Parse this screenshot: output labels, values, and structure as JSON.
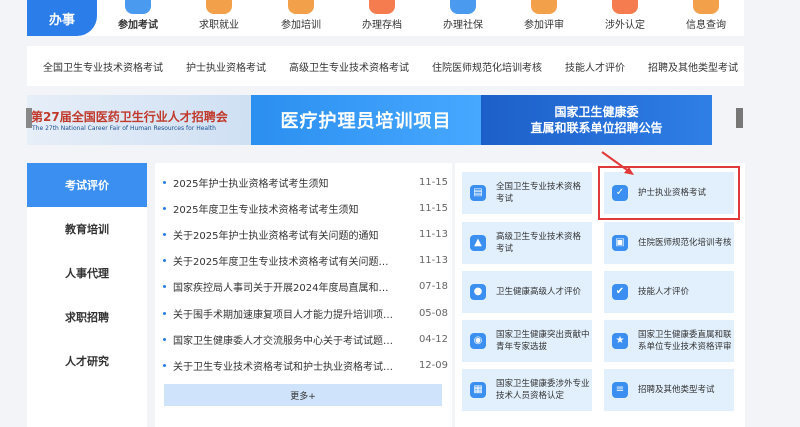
{
  "top_nav": {
    "section_title": "办事",
    "items": [
      {
        "label": "参加考试",
        "color": "#4a9af0"
      },
      {
        "label": "求职就业",
        "color": "#f2a14a"
      },
      {
        "label": "参加培训",
        "color": "#f2a14a"
      },
      {
        "label": "办理存档",
        "color": "#f47c4f"
      },
      {
        "label": "办理社保",
        "color": "#4a9af0"
      },
      {
        "label": "参加评审",
        "color": "#f2a14a"
      },
      {
        "label": "涉外认定",
        "color": "#f47c4f"
      },
      {
        "label": "信息查询",
        "color": "#f2a14a"
      }
    ]
  },
  "categories": [
    "全国卫生专业技术资格考试",
    "护士执业资格考试",
    "高级卫生专业技术资格考试",
    "住院医师规范化培训考核",
    "技能人才评价",
    "招聘及其他类型考试"
  ],
  "banner": {
    "panel1_title": "第27届全国医药卫生行业人才招聘会",
    "panel1_subtitle": "The 27th National Career Fair of Human Resources for Health",
    "panel2_title": "医疗护理员培训项目",
    "panel3_line1": "国家卫生健康委",
    "panel3_line2": "直属和联系单位招聘公告"
  },
  "tabs": [
    "考试评价",
    "教育培训",
    "人事代理",
    "求职招聘",
    "人才研究"
  ],
  "news": [
    {
      "title": "2025年护士执业资格考试考生须知",
      "date": "11-15"
    },
    {
      "title": "2025年度卫生专业技术资格考试考生须知",
      "date": "11-15"
    },
    {
      "title": "关于2025年护士执业资格考试有关问题的通知",
      "date": "11-13"
    },
    {
      "title": "关于2025年度卫生专业技术资格考试有关问题的通...",
      "date": "11-13"
    },
    {
      "title": "国家疾控局人事司关于开展2024年度局直属和联系...",
      "date": "07-18"
    },
    {
      "title": "关于围手术期加速康复项目人才能力提升培训项目...",
      "date": "05-08"
    },
    {
      "title": "国家卫生健康委人才交流服务中心关于考试试题版...",
      "date": "04-12"
    },
    {
      "title": "关于卫生专业技术资格考试和护士执业资格考试的...",
      "date": "12-09"
    }
  ],
  "more_label": "更多+",
  "services": [
    {
      "label": "全国卫生专业技术资格考试",
      "icon": "document-icon"
    },
    {
      "label": "护士执业资格考试",
      "icon": "clipboard-check-icon"
    },
    {
      "label": "高级卫生专业技术资格考试",
      "icon": "graduation-cap-icon"
    },
    {
      "label": "住院医师规范化培训考核",
      "icon": "id-card-icon"
    },
    {
      "label": "卫生健康高级人才评价",
      "icon": "medal-icon"
    },
    {
      "label": "技能人才评价",
      "icon": "check-circle-icon"
    },
    {
      "label": "国家卫生健康突出贡献中青年专家选拔",
      "icon": "person-card-icon"
    },
    {
      "label": "国家卫生健康委直属和联系单位专业技术资格评审",
      "icon": "award-icon"
    },
    {
      "label": "国家卫生健康委涉外专业技术人员资格认定",
      "icon": "certificate-icon"
    },
    {
      "label": "招聘及其他类型考试",
      "icon": "list-icon"
    }
  ],
  "colors": {
    "accent": "#3b8ff0",
    "highlight": "#e03a3a",
    "card_bg": "#e2f0fd"
  }
}
